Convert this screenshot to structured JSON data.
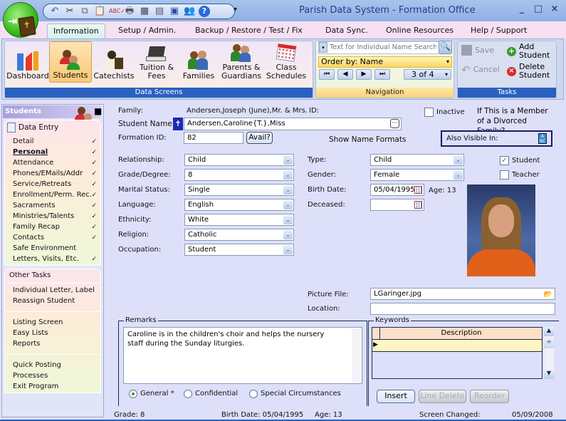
{
  "window": {
    "title": "Parish Data System - Formation Office",
    "controls": [
      "_",
      "□",
      "×"
    ]
  },
  "quick_access": [
    "undo-icon",
    "cut-icon",
    "copy-icon",
    "paste-icon",
    "spellcheck-icon",
    "print-icon",
    "calculator-icon",
    "grid-icon",
    "monitor-icon",
    "users-icon",
    "help-icon"
  ],
  "tabs": [
    {
      "label": "Information",
      "active": true
    },
    {
      "label": "Setup / Admin."
    },
    {
      "label": "Backup / Restore / Test / Fix"
    },
    {
      "label": "Data Sync."
    },
    {
      "label": "Online Resources"
    },
    {
      "label": "Help / Support"
    }
  ],
  "ribbon": {
    "data_screens": {
      "label": "Data Screens",
      "buttons": [
        "Dashboard",
        "Students",
        "Catechists",
        "Tuition &\nFees",
        "Families",
        "Parents &\nGuardians",
        "Class\nSchedules"
      ],
      "selected": "Students"
    },
    "navigation": {
      "label": "Navigation",
      "search_placeholder": "Text for Individual Name Search...",
      "order_by": "Order by:  Name",
      "record": "3 of 4",
      "nav_first": "⏮",
      "nav_prev": "◀",
      "nav_next": "▶",
      "nav_last": "⏭"
    },
    "tasks": {
      "label": "Tasks",
      "save": "Save",
      "cancel": "Cancel",
      "add": "Add\nStudent",
      "delete": "Delete\nStudent"
    }
  },
  "sidebar": {
    "header": "Students",
    "data_entry": "Data Entry",
    "items": [
      {
        "label": "Detail",
        "check": true
      },
      {
        "label": "Personal",
        "check": true,
        "selected": true
      },
      {
        "label": "Attendance",
        "check": true
      },
      {
        "label": "Phones/EMails/Addr",
        "check": true
      },
      {
        "label": "Service/Retreats",
        "check": true
      },
      {
        "label": "Enrollment/Perm. Rec.",
        "check": true
      },
      {
        "label": "Sacraments",
        "check": true
      },
      {
        "label": "Ministries/Talents",
        "check": true
      },
      {
        "label": "Family Recap",
        "check": true
      },
      {
        "label": "Contacts",
        "check": true
      },
      {
        "label": "Safe Environment",
        "check": false
      },
      {
        "label": "Letters, Visits, Etc.",
        "check": true
      }
    ],
    "other_tasks": "Other Tasks",
    "task_groups": [
      [
        "Individual Letter, Label",
        "Reassign Student"
      ],
      [
        "Listing Screen",
        "Easy Lists",
        "Reports"
      ],
      [
        "Quick Posting",
        "Processes",
        "Exit Program"
      ]
    ],
    "check_glyph": "✓"
  },
  "form": {
    "family_label": "Family:",
    "family_value": "Andersen,Joseph (June),Mr. & Mrs.",
    "id_label": "ID:",
    "student_name_label": "Student Name:",
    "student_name": "Andersen,Caroline{T.},Miss",
    "formation_id_label": "Formation ID:",
    "formation_id": "82",
    "avail_button": "Avail?",
    "show_name_formats": "Show Name Formats",
    "inactive_label": "Inactive",
    "divorced_note": "If This is a Member of a Divorced Family?",
    "also_visible": "Also Visible In:",
    "left_fields": [
      {
        "label": "Relationship:",
        "value": "Child"
      },
      {
        "label": "Grade/Degree:",
        "value": "8"
      },
      {
        "label": "Marital Status:",
        "value": "Single"
      },
      {
        "label": "Language:",
        "value": "English"
      },
      {
        "label": "Ethnicity:",
        "value": "White"
      },
      {
        "label": "Religion:",
        "value": "Catholic"
      },
      {
        "label": "Occupation:",
        "value": "Student"
      }
    ],
    "type_label": "Type:",
    "type_value": "Child",
    "gender_label": "Gender:",
    "gender_value": "Female",
    "birth_label": "Birth Date:",
    "birth_value": "05/04/1995",
    "age_text": "Age: 13",
    "deceased_label": "Deceased:",
    "deceased_value": "",
    "student_check": {
      "label": "Student",
      "checked": true
    },
    "teacher_check": {
      "label": "Teacher",
      "checked": false
    },
    "picture_label": "Picture File:",
    "picture_value": "LGaringer.jpg",
    "location_label": "Location:",
    "location_value": "",
    "remarks_legend": "Remarks",
    "remarks_text": "Caroline is in the children's choir and helps the nursery staff during the Sunday liturgies.",
    "radios": [
      {
        "label": "General *",
        "selected": true
      },
      {
        "label": "Confidential",
        "selected": false
      },
      {
        "label": "Special Circumstances",
        "selected": false
      }
    ],
    "keywords_legend": "Keywords",
    "keywords_header": "Description",
    "keywords_rows": [
      ""
    ],
    "insert": "Insert",
    "line_delete": "Line Delete",
    "reorder": "Reorder"
  },
  "status": {
    "grade": "Grade:  8",
    "birth": "Birth Date:  05/04/1995",
    "age": "Age: 13",
    "changed_label": "Screen Changed:",
    "changed_value": "05/09/2008"
  }
}
